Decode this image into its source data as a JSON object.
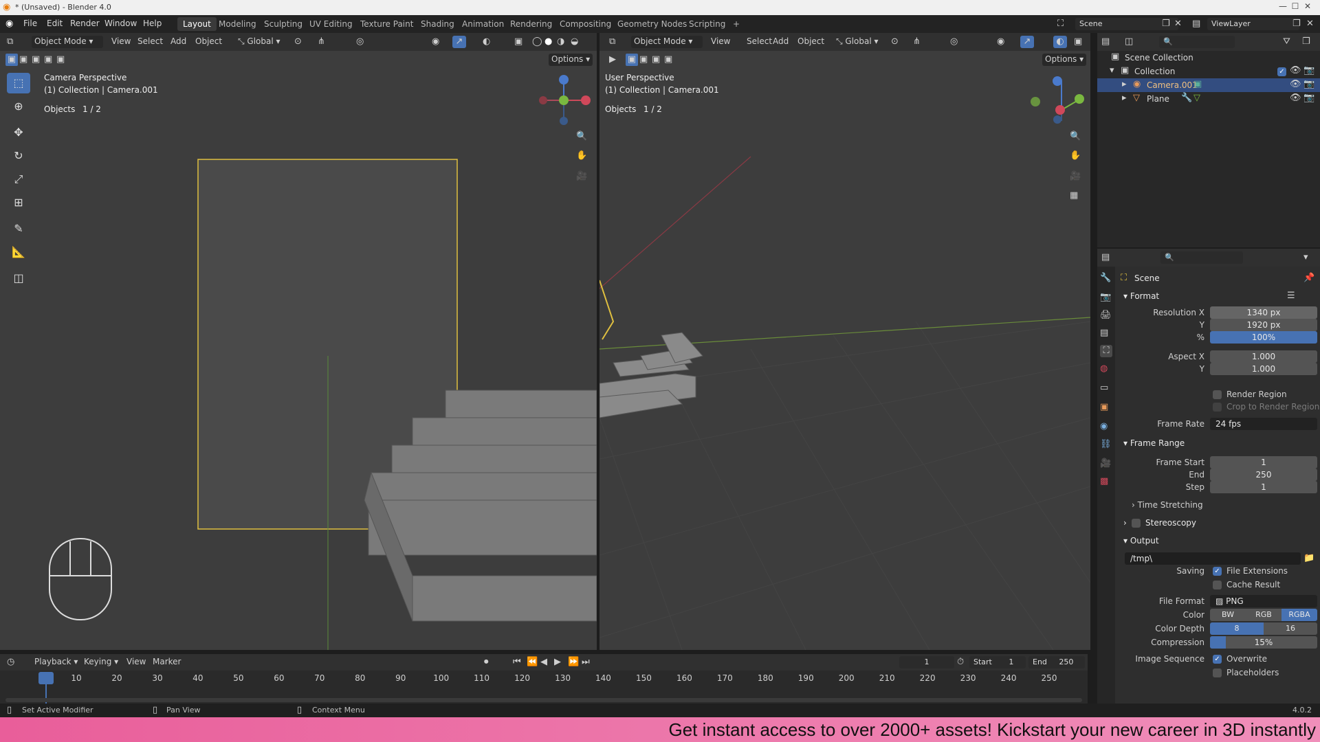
{
  "window": {
    "title": "* (Unsaved) - Blender 4.0"
  },
  "menu": [
    "File",
    "Edit",
    "Render",
    "Window",
    "Help"
  ],
  "workspaces": [
    "Layout",
    "Modeling",
    "Sculpting",
    "UV Editing",
    "Texture Paint",
    "Shading",
    "Animation",
    "Rendering",
    "Compositing",
    "Geometry Nodes",
    "Scripting"
  ],
  "active_workspace": "Layout",
  "scene": {
    "name": "Scene",
    "view_layer": "ViewLayer"
  },
  "viewport_left": {
    "mode": "Object Mode",
    "menus": [
      "View",
      "Select",
      "Add",
      "Object"
    ],
    "transform": "Global",
    "options": "Options",
    "overlay_title": "Camera Perspective",
    "overlay_collection": "(1) Collection | Camera.001",
    "objects_label": "Objects",
    "objects_count": "1 / 2"
  },
  "viewport_right": {
    "mode": "Object Mode",
    "menus": [
      "View",
      "Select",
      "Add",
      "Object"
    ],
    "transform": "Global",
    "options": "Options",
    "overlay_title": "User Perspective",
    "overlay_collection": "(1) Collection | Camera.001",
    "objects_label": "Objects",
    "objects_count": "1 / 2"
  },
  "outliner": {
    "root": "Scene Collection",
    "collection": "Collection",
    "items": [
      "Camera.001",
      "Plane"
    ]
  },
  "properties": {
    "context": "Scene",
    "format": {
      "header": "Format",
      "res_x_label": "Resolution X",
      "res_x": "1340 px",
      "res_y_label": "Y",
      "res_y": "1920 px",
      "pct_label": "%",
      "pct": "100%",
      "aspect_x_label": "Aspect X",
      "aspect_x": "1.000",
      "aspect_y_label": "Y",
      "aspect_y": "1.000",
      "render_region": "Render Region",
      "crop": "Crop to Render Region",
      "frame_rate_label": "Frame Rate",
      "frame_rate": "24 fps"
    },
    "frame_range": {
      "header": "Frame Range",
      "start_label": "Frame Start",
      "start": "1",
      "end_label": "End",
      "end": "250",
      "step_label": "Step",
      "step": "1"
    },
    "time_stretching": "Time Stretching",
    "stereoscopy": "Stereoscopy",
    "output": {
      "header": "Output",
      "path": "/tmp\\",
      "saving_label": "Saving",
      "file_ext": "File Extensions",
      "cache": "Cache Result",
      "file_format_label": "File Format",
      "file_format": "PNG",
      "color_label": "Color",
      "color_options": [
        "BW",
        "RGB",
        "RGBA"
      ],
      "color_selected": "RGBA",
      "depth_label": "Color Depth",
      "depth_options": [
        "8",
        "16"
      ],
      "depth_selected": "8",
      "compression_label": "Compression",
      "compression": "15%",
      "compression_value": 0.15,
      "image_seq_label": "Image Sequence",
      "overwrite": "Overwrite",
      "placeholders": "Placeholders"
    }
  },
  "timeline": {
    "menus": [
      "Playback",
      "Keying",
      "View",
      "Marker"
    ],
    "current_frame": "1",
    "start_label": "Start",
    "start": "1",
    "end_label": "End",
    "end": "250",
    "ticks": [
      "1",
      "10",
      "20",
      "30",
      "40",
      "50",
      "60",
      "70",
      "80",
      "90",
      "100",
      "110",
      "120",
      "130",
      "140",
      "150",
      "160",
      "170",
      "180",
      "190",
      "200",
      "210",
      "220",
      "230",
      "240",
      "250"
    ]
  },
  "status": {
    "left": "Set Active Modifier",
    "mid": "Pan View",
    "right": "Context Menu",
    "version": "4.0.2"
  },
  "banner": "Get instant access to over 2000+ assets! Kickstart your new career in 3D instantly"
}
